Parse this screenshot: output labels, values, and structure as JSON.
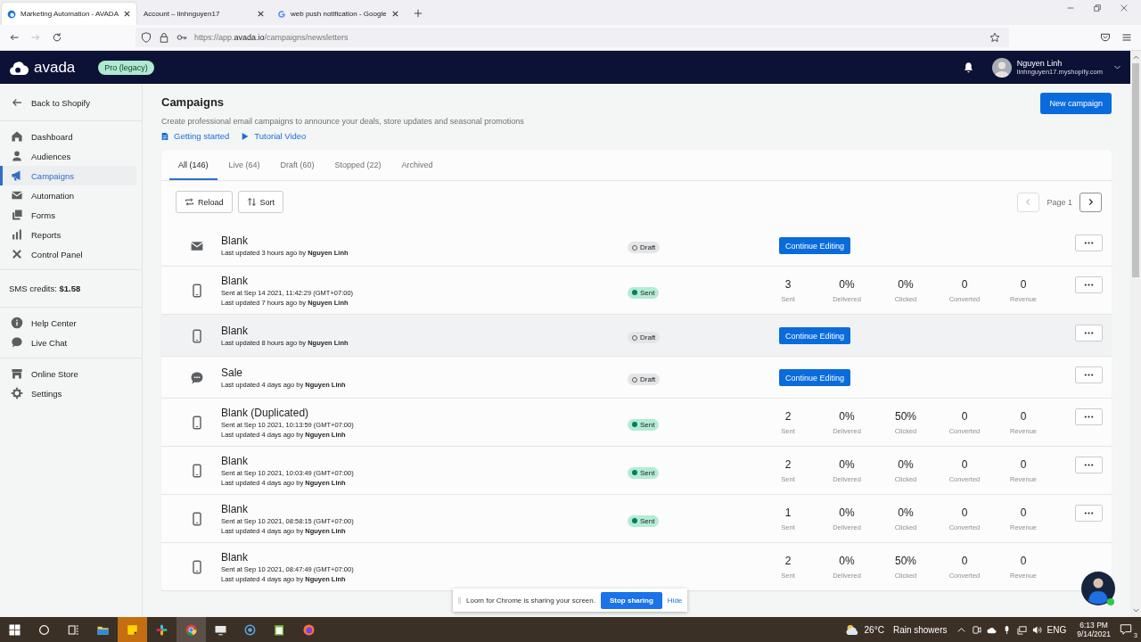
{
  "browser": {
    "tabs": [
      {
        "title": "Marketing Automation - AVADA",
        "selected": true
      },
      {
        "title": "Account – linhnguyen17",
        "selected": false
      },
      {
        "title": "web push notification - Google",
        "selected": false
      }
    ],
    "address": {
      "host_prefix": "https://app.",
      "domain": "avada.io",
      "path": "/campaigns/newsletters"
    }
  },
  "header": {
    "logo": "avada",
    "plan_badge": "Pro (legacy)",
    "user_name": "Nguyen Linh",
    "user_shop": "linhnguyen17.myshopify.com"
  },
  "sidebar": {
    "back": "Back to Shopify",
    "items": [
      {
        "label": "Dashboard",
        "selected": false
      },
      {
        "label": "Audiences",
        "selected": false
      },
      {
        "label": "Campaigns",
        "selected": true
      },
      {
        "label": "Automation",
        "selected": false
      },
      {
        "label": "Forms",
        "selected": false
      },
      {
        "label": "Reports",
        "selected": false
      },
      {
        "label": "Control Panel",
        "selected": false
      }
    ],
    "sms_credits": "SMS credits: **$1.58**",
    "help_items": [
      "Help Center",
      "Live Chat"
    ],
    "store_items": [
      "Online Store",
      "Settings"
    ]
  },
  "page": {
    "title": "Campaigns",
    "subtitle": "Create professional email campaigns to announce your deals, store updates and seasonal promotions",
    "links": [
      "Getting started",
      "Tutorial Video"
    ],
    "primary_button": "New campaign"
  },
  "tabs": [
    {
      "label": "All (146)",
      "selected": true
    },
    {
      "label": "Live (64)",
      "selected": false
    },
    {
      "label": "Draft (60)",
      "selected": false
    },
    {
      "label": "Stopped (22)",
      "selected": false
    },
    {
      "label": "Archived",
      "selected": false
    }
  ],
  "toolbar": {
    "buttons": [
      "Reload",
      "Sort"
    ],
    "page": "Page 1",
    "prev_disabled": true
  },
  "campaigns": [
    {
      "kind": "email",
      "name": "Blank",
      "updated": "Last updated 3 hours ago by **Nguyen Linh**",
      "status": "Draft",
      "sent": false,
      "action": "Continue Editing",
      "highlighted": false,
      "has_menu": true
    },
    {
      "kind": "sms",
      "name": "Blank",
      "sent_at": "Sent at Sep 14 2021, 11:42:29 (GMT+07:00)",
      "updated": "Last updated 7 hours ago by **Nguyen Linh**",
      "status": "Sent",
      "sent": true,
      "stats": [
        {
          "value": "3",
          "label": "Sent"
        },
        {
          "value": "0%",
          "label": "Delivered"
        },
        {
          "value": "0%",
          "label": "Clicked"
        },
        {
          "value": "0",
          "label": "Converted"
        },
        {
          "value": "0",
          "label": "Revenue"
        }
      ],
      "highlighted": false,
      "has_menu": true
    },
    {
      "kind": "sms",
      "name": "Blank",
      "updated": "Last updated 8 hours ago by **Nguyen Linh**",
      "status": "Draft",
      "sent": false,
      "action": "Continue Editing",
      "highlighted": true,
      "has_menu": true
    },
    {
      "kind": "chat",
      "name": "Sale",
      "updated": "Last updated 4 days ago by **Nguyen Linh**",
      "status": "Draft",
      "sent": false,
      "action": "Continue Editing",
      "highlighted": false,
      "has_menu": true
    },
    {
      "kind": "sms",
      "name": "Blank (Duplicated)",
      "sent_at": "Sent at Sep 10 2021, 10:13:59 (GMT+07:00)",
      "updated": "Last updated 4 days ago by **Nguyen Linh**",
      "status": "Sent",
      "sent": true,
      "stats": [
        {
          "value": "2",
          "label": "Sent"
        },
        {
          "value": "0%",
          "label": "Delivered"
        },
        {
          "value": "50%",
          "label": "Clicked"
        },
        {
          "value": "0",
          "label": "Converted"
        },
        {
          "value": "0",
          "label": "Revenue"
        }
      ],
      "highlighted": false,
      "has_menu": true
    },
    {
      "kind": "sms",
      "name": "Blank",
      "sent_at": "Sent at Sep 10 2021, 10:03:49 (GMT+07:00)",
      "updated": "Last updated 4 days ago by **Nguyen Linh**",
      "status": "Sent",
      "sent": true,
      "stats": [
        {
          "value": "2",
          "label": "Sent"
        },
        {
          "value": "0%",
          "label": "Delivered"
        },
        {
          "value": "0%",
          "label": "Clicked"
        },
        {
          "value": "0",
          "label": "Converted"
        },
        {
          "value": "0",
          "label": "Revenue"
        }
      ],
      "highlighted": false,
      "has_menu": true
    },
    {
      "kind": "sms",
      "name": "Blank",
      "sent_at": "Sent at Sep 10 2021, 08:58:15 (GMT+07:00)",
      "updated": "Last updated 4 days ago by **Nguyen Linh**",
      "status": "Sent",
      "sent": true,
      "stats": [
        {
          "value": "1",
          "label": "Sent"
        },
        {
          "value": "0%",
          "label": "Delivered"
        },
        {
          "value": "0%",
          "label": "Clicked"
        },
        {
          "value": "0",
          "label": "Converted"
        },
        {
          "value": "0",
          "label": "Revenue"
        }
      ],
      "highlighted": false,
      "has_menu": true
    },
    {
      "kind": "sms",
      "name": "Blank",
      "sent_at": "Sent at Sep 10 2021, 08:47:49 (GMT+07:00)",
      "updated": "Last updated 4 days ago by **Nguyen Linh**",
      "stats": [
        {
          "value": "2",
          "label": "Sent"
        },
        {
          "value": "0%",
          "label": "Delivered"
        },
        {
          "value": "50%",
          "label": "Clicked"
        },
        {
          "value": "0",
          "label": "Converted"
        },
        {
          "value": "0",
          "label": "Revenue"
        }
      ],
      "highlighted": false,
      "has_menu": false
    }
  ],
  "loom": {
    "message": "Loom for Chrome is sharing your screen.",
    "stop": "Stop sharing",
    "hide": "Hide"
  },
  "taskbar": {
    "temperature": "26°C",
    "weather": "Rain showers",
    "language": "ENG",
    "time": "6:13 PM",
    "date": "9/14/2021",
    "notifications": "3"
  }
}
